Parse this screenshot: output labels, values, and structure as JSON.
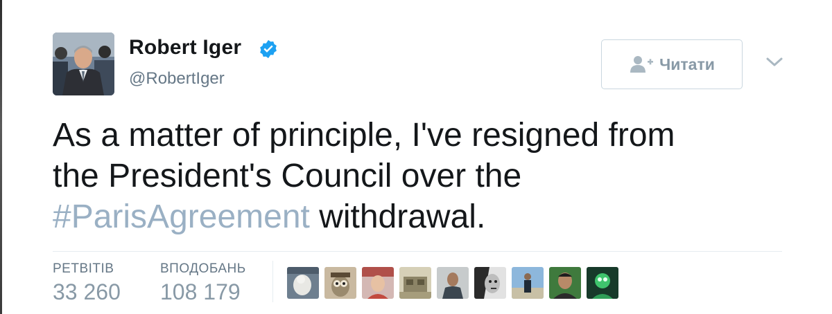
{
  "tweet": {
    "author": {
      "name": "Robert Iger",
      "handle": "@RobertIger",
      "verified": true,
      "avatar_icon": "avatar-photo"
    },
    "follow_button": {
      "label": "Читати",
      "icon": "follow-person-plus-icon"
    },
    "menu_icon": "chevron-down-icon",
    "text": {
      "line1": "As a matter of principle, I've resigned from",
      "line2": "the President's Council over the",
      "hashtag": "#ParisAgreement",
      "line3_rest": " withdrawal."
    },
    "stats": {
      "retweets_label": "РЕТВІТІВ",
      "retweets_value": "33 260",
      "likes_label": "ВПОДОБАНЬ",
      "likes_value": "108 179"
    },
    "liker_avatars": [
      "liker-avatar",
      "liker-avatar",
      "liker-avatar",
      "liker-avatar",
      "liker-avatar",
      "liker-avatar",
      "liker-avatar",
      "liker-avatar",
      "liker-avatar"
    ]
  },
  "colors": {
    "text": "#14171a",
    "secondary": "#657786",
    "muted": "#8899a6",
    "hashtag": "#9ab0c4",
    "verified": "#1da1f2",
    "border": "#c9d6df"
  }
}
